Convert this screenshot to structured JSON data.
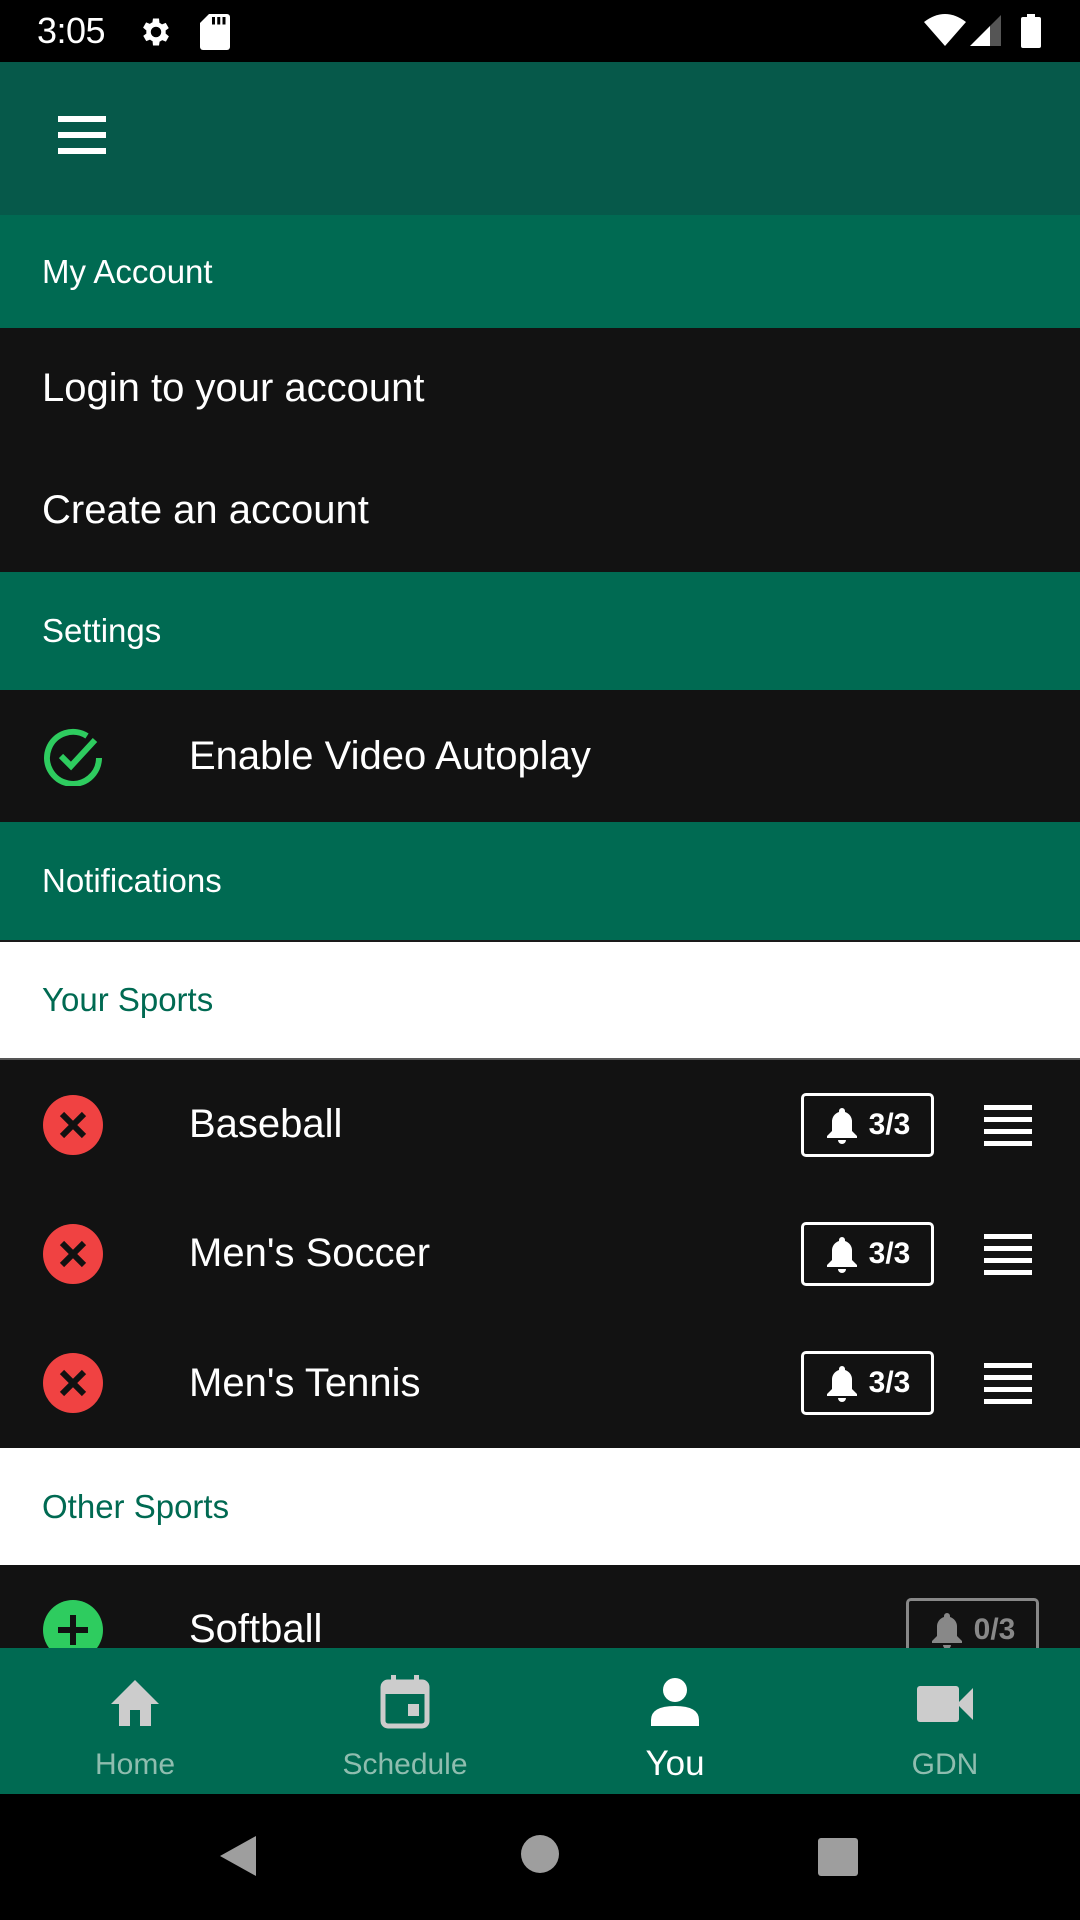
{
  "status_bar": {
    "time": "3:05",
    "left_icons": [
      "gear-icon",
      "sd-card-icon"
    ],
    "right_icons": [
      "wifi-icon",
      "cell-signal-icon",
      "battery-icon"
    ]
  },
  "header": {
    "menu_icon": "hamburger-menu-icon"
  },
  "sections": {
    "my_account": {
      "title": "My Account",
      "items": [
        "Login to your account",
        "Create an account"
      ]
    },
    "settings": {
      "title": "Settings",
      "items": [
        {
          "label": "Enable Video Autoplay",
          "enabled": true,
          "icon": "check-circle-icon"
        }
      ]
    },
    "notifications": {
      "title": "Notifications",
      "your_sports": {
        "title": "Your Sports",
        "items": [
          {
            "name": "Baseball",
            "alerts": "3/3",
            "action": "remove"
          },
          {
            "name": "Men's Soccer",
            "alerts": "3/3",
            "action": "remove"
          },
          {
            "name": "Men's Tennis",
            "alerts": "3/3",
            "action": "remove"
          }
        ]
      },
      "other_sports": {
        "title": "Other Sports",
        "items": [
          {
            "name": "Softball",
            "alerts": "0/3",
            "action": "add"
          }
        ]
      }
    }
  },
  "bottom_nav": {
    "items": [
      {
        "label": "Home",
        "icon": "home-icon",
        "active": false
      },
      {
        "label": "Schedule",
        "icon": "calendar-icon",
        "active": false
      },
      {
        "label": "You",
        "icon": "person-icon",
        "active": true
      },
      {
        "label": "GDN",
        "icon": "video-camera-icon",
        "active": false
      }
    ]
  },
  "system_nav": [
    "back-icon",
    "home-circle-icon",
    "recents-icon"
  ],
  "colors": {
    "header": "#06594A",
    "section_band": "#006A52",
    "row_background": "#121212",
    "remove": "#F04242",
    "add_enabled": "#2ECC5F"
  }
}
